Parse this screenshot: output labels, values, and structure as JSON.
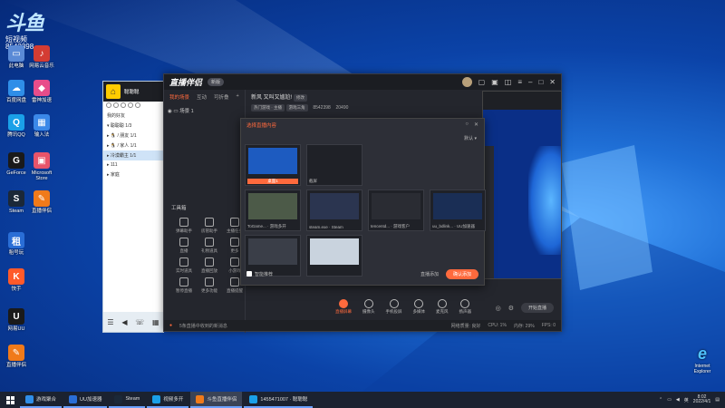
{
  "desktop": {
    "watermark_logo": "斗鱼",
    "watermark_badge": "短视频",
    "watermark_id": "8542398",
    "icons": [
      {
        "label": "此电脑",
        "color": "#5a8ad6",
        "glyph": "▭"
      },
      {
        "label": "网易云音乐",
        "color": "#d43c33",
        "glyph": "♪"
      },
      {
        "label": "百度网盘",
        "color": "#2f8ee8",
        "glyph": "☁"
      },
      {
        "label": "雷神加速",
        "color": "#e84d8a",
        "glyph": "◆"
      },
      {
        "label": "腾讯QQ",
        "color": "#1aa0e8",
        "glyph": "Q"
      },
      {
        "label": "输入法",
        "color": "#3b88e8",
        "glyph": "▦"
      },
      {
        "label": "GeForce",
        "color": "#1a1a1a",
        "glyph": "G"
      },
      {
        "label": "Microsoft Store",
        "color": "#e8546a",
        "glyph": "▣"
      },
      {
        "label": "Steam",
        "color": "#1b2838",
        "glyph": "S"
      },
      {
        "label": "直播伴侣",
        "color": "#f07a1a",
        "glyph": "✎"
      },
      {
        "label": "租号玩",
        "color": "#2a6ed6",
        "glyph": "租"
      },
      {
        "label": "快手",
        "color": "#ff5a2a",
        "glyph": "K"
      },
      {
        "label": "网易UU",
        "color": "#1a1a1a",
        "glyph": "U"
      },
      {
        "label": "直播伴侣",
        "color": "#f07a1a",
        "glyph": "✎"
      }
    ],
    "ie_label": "Internet Explorer"
  },
  "qq_window": {
    "title": "聪聪聪",
    "rows": [
      "我的好友",
      "▾ 聪聪聪 1/3",
      "▸ 🐧 / 朋友 1/1",
      "▸ 🐧 / 家人 1/1",
      "▸ 冷漠霸主 1/1",
      "▸ 111",
      "▸ 家庭"
    ],
    "selected_row": 4
  },
  "app": {
    "brand": "直播伴侣",
    "brand_badge": "新版",
    "tabs": [
      "我的场景",
      "互动",
      "可折叠"
    ],
    "active_tab": 0,
    "scene_label": "场景 1",
    "stream_title": "新风 又叫又尴尬!",
    "edit_label": "修改",
    "tag1": "热门游戏 · 主播",
    "tag2": "游戏三角",
    "room_id": "8542398",
    "fans": "20490",
    "tools_title": "工具箱",
    "tools": [
      "弹幕助手",
      "房管助手",
      "主播任务",
      "直播",
      "礼物道具",
      "更多",
      "实时道具",
      "直播回放",
      "小游戏",
      "暂停直播",
      "更多功能",
      "直播提醒"
    ],
    "bottom_buttons": [
      "直播屏幕",
      "摄像头",
      "手机投屏",
      "多媒体",
      "麦克风",
      "扬声器"
    ],
    "start_label": "开始直播",
    "status_warning": "5条直播中收到的新消息",
    "status_items": [
      "网络质量: 良好",
      "CPU: 1%",
      "内存: 29%",
      "FPS: 0"
    ]
  },
  "dialog": {
    "title": "选择直播内容",
    "sort": "默认 ▾",
    "thumbs": [
      {
        "caption": "桌面1",
        "selected": true,
        "color": "#1d5bc0"
      },
      {
        "caption": "截屏",
        "selected": false,
        "color": "#1f2127"
      },
      {
        "caption": "ToGame... · 游戏多开",
        "selected": false,
        "color": "#4c5a48"
      },
      {
        "caption": "steam.exe · Steam",
        "selected": false,
        "color": "#2b3550"
      },
      {
        "caption": "tencentd... · 游戏客户",
        "selected": false,
        "color": "#2a2c33"
      },
      {
        "caption": "uu_bdlink... · UU加速器",
        "selected": false,
        "color": "#1a2e55"
      },
      {
        "caption": "",
        "selected": false,
        "color": "#3a3e48"
      },
      {
        "caption": "",
        "selected": false,
        "color": "#c9d3de"
      }
    ],
    "checkbox_label": "智能推荐",
    "cancel_label": "直播添加",
    "confirm_label": "确认添加"
  },
  "taskbar": {
    "items": [
      {
        "label": "游戏聚合",
        "color": "#2f8ee8"
      },
      {
        "label": "UU加速器",
        "color": "#2a6ed6"
      },
      {
        "label": "Steam",
        "color": "#1b2838"
      },
      {
        "label": "视频多开",
        "color": "#1aa0e8"
      },
      {
        "label": "斗鱼直播伴侣",
        "color": "#f07a1a"
      },
      {
        "label": "1455471007 · 聪聪聪",
        "color": "#1aa0e8"
      }
    ],
    "active_index": 4,
    "time": "8:02",
    "date": "2022/4/1",
    "tray_lang": "英"
  }
}
